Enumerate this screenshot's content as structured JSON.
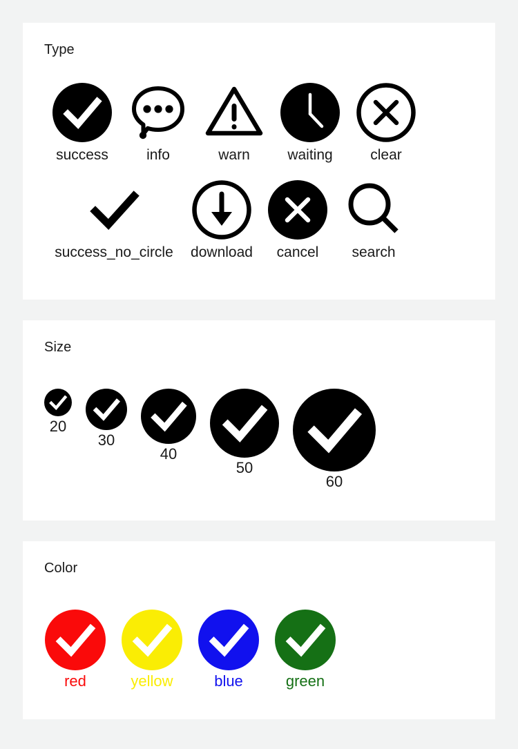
{
  "sections": {
    "type": {
      "title": "Type",
      "rows": [
        [
          {
            "label": "success",
            "icon": "success-check-circle-filled-icon"
          },
          {
            "label": "info",
            "icon": "info-speech-bubble-icon"
          },
          {
            "label": "warn",
            "icon": "warn-triangle-exclamation-icon"
          },
          {
            "label": "waiting",
            "icon": "waiting-clock-filled-icon"
          },
          {
            "label": "clear",
            "icon": "clear-x-circle-outline-icon"
          }
        ],
        [
          {
            "label": "success_no_circle",
            "icon": "check-no-circle-icon"
          },
          {
            "label": "download",
            "icon": "download-arrow-circle-icon"
          },
          {
            "label": "cancel",
            "icon": "cancel-x-circle-filled-icon"
          },
          {
            "label": "search",
            "icon": "search-magnifier-icon"
          }
        ]
      ]
    },
    "size": {
      "title": "Size",
      "items": [
        {
          "label": "20",
          "size": 40
        },
        {
          "label": "30",
          "size": 60
        },
        {
          "label": "40",
          "size": 80
        },
        {
          "label": "50",
          "size": 100
        },
        {
          "label": "60",
          "size": 120
        }
      ]
    },
    "color": {
      "title": "Color",
      "items": [
        {
          "label": "red",
          "color": "#fa0a0a"
        },
        {
          "label": "yellow",
          "color": "#faed04"
        },
        {
          "label": "blue",
          "color": "#1111ee"
        },
        {
          "label": "green",
          "color": "#157015"
        }
      ]
    }
  },
  "palette": {
    "page_background": "#f2f3f3",
    "card_background": "#ffffff",
    "icon_black": "#000000",
    "check_white": "#ffffff",
    "text": "#1a1a1a"
  }
}
